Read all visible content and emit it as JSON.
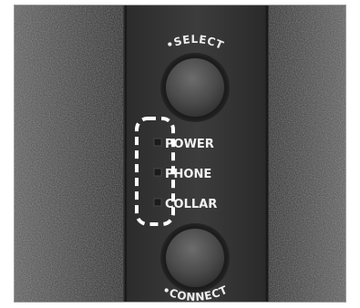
{
  "buttons": {
    "select_label": "SELECT",
    "connect_label": "CONNECT"
  },
  "indicators": [
    {
      "label": "POWER"
    },
    {
      "label": "PHONE"
    },
    {
      "label": "COLLAR"
    }
  ],
  "highlight": {
    "style": "dashed",
    "color": "#ffffff"
  }
}
